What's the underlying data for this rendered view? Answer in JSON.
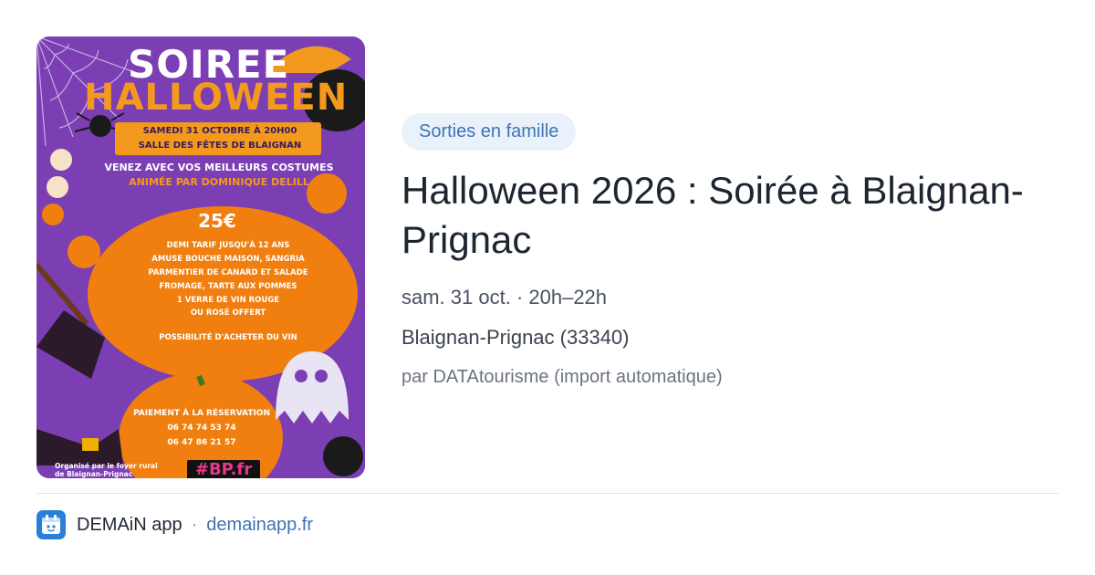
{
  "poster": {
    "soiree": "SOIREE",
    "halloween": "HALLOWEEN",
    "date": "SAMEDI 31 OCTOBRE À 20H00",
    "salle": "SALLE DES FÊTES DE BLAIGNAN",
    "costumes": "VENEZ AVEC VOS MEILLEURS COSTUMES",
    "animee": "ANIMÉE PAR DOMINIQUE DELILL",
    "price": "25€",
    "menu": [
      "DEMI TARIF JUSQU'À 12 ANS",
      "AMUSE BOUCHE MAISON, SANGRIA",
      "PARMENTIER DE CANARD ET SALADE",
      "FROMAGE, TARTE AUX POMMES",
      "1 VERRE DE VIN ROUGE",
      "OU ROSÉ OFFERT",
      "POSSIBILITÉ D'ACHETER DU VIN"
    ],
    "paiement": "PAIEMENT À LA RÉSERVATION",
    "phones": [
      "06 74 74 53 74",
      "06 47 86 21 57"
    ],
    "organise": "Organisé par le foyer rural de Blaignan-Prignac",
    "tag": "#BP.fr"
  },
  "event": {
    "category": "Sorties en famille",
    "title": "Halloween 2026 : Soirée à Blaignan-Prignac",
    "date": "sam. 31 oct. · 20h–22h",
    "place": "Blaignan-Prignac (33340)",
    "by": "par DATAtourisme (import automatique)"
  },
  "footer": {
    "app_name": "DEMAiN app",
    "separator": "·",
    "url": "demainapp.fr",
    "icon": "demain-app-icon"
  },
  "colors": {
    "accent": "#3f73b4",
    "chip_bg": "#e9f1fb",
    "poster_purple": "#7b3fb3",
    "poster_orange": "#f39a1e"
  }
}
